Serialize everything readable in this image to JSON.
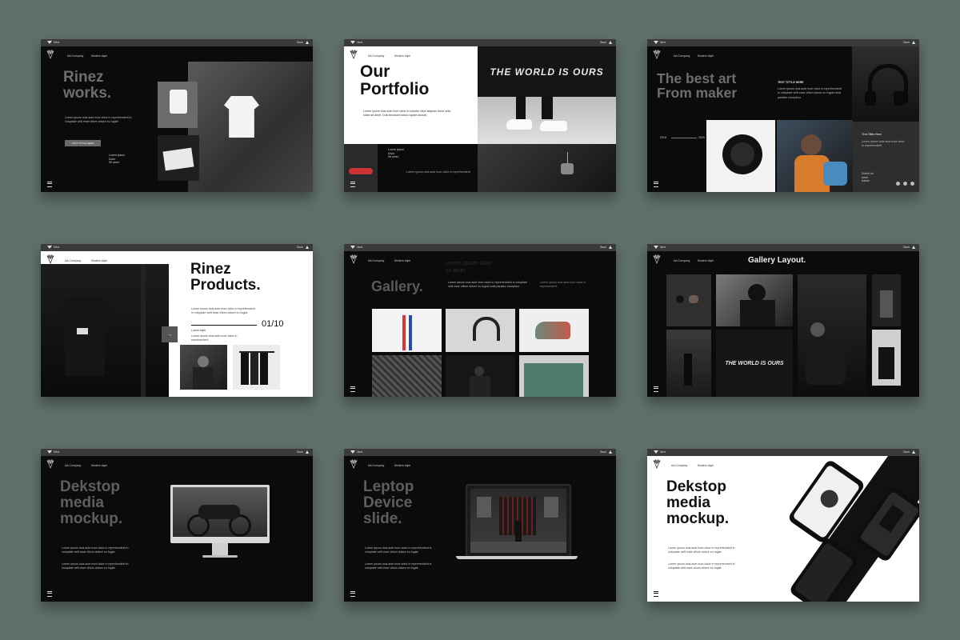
{
  "topbar": {
    "next": "Next",
    "back": "Back"
  },
  "meta": {
    "company": "AA Company",
    "style": "Modern style"
  },
  "lorem": {
    "short": "Lorem ipsum duis aute irure dolor in reprehenderit",
    "medium": "Lorem ipsum duis aute irure dolor in reprehenderit in voluptate velit esse cillum dolore eu fugiat",
    "long": "Lorem ipsum duis aute irure dolor in reprehenderit in voluptate velit esse cillum dolore eu fugiat nulla pariatur excepteur"
  },
  "slide1": {
    "title": "Rinez\nworks.",
    "button": "TEXT TITTLE HERE",
    "side": "Lorem ipsum\nDolor\nSit amet"
  },
  "slide2": {
    "title": "Our\nPortfolio",
    "body": "Lorem ipsum duis aute irure dolor in lobortis ollue aliquam dolor velis ullam sit amet. Duis tincidunt luctus ropate dolorat.",
    "caption": "Lorem ipsum\nDolor\nSit amet.",
    "neon": "THE WORLD IS OURS"
  },
  "slide3": {
    "title": "The best art\nFrom maker",
    "label": "TEXT TITTLE HERE",
    "year_start": "2018",
    "year_end": "2020",
    "side_title": "Text Tittle Here",
    "side_body": "Dolorit sit\namet\nlobore"
  },
  "slide4": {
    "title": "Rinez\nProducts.",
    "counter": "01/10",
    "label": "Lorem style"
  },
  "slide5": {
    "title": "Gallery.",
    "ghost": "Lorem ipsum dolor\nsit amet"
  },
  "slide6": {
    "title": "Gallery  Layout.",
    "neon": "THE WORLD IS OURS"
  },
  "slide7": {
    "title": "Dekstop\nmedia\nmockup."
  },
  "slide8": {
    "title": "Leptop\nDevice\nslide."
  },
  "slide9": {
    "title": "Dekstop\nmedia\nmockup."
  },
  "colors": {
    "background": "#5f6f6a",
    "dark_slide": "#0b0b0b",
    "topbar": "#3a3a3a"
  }
}
